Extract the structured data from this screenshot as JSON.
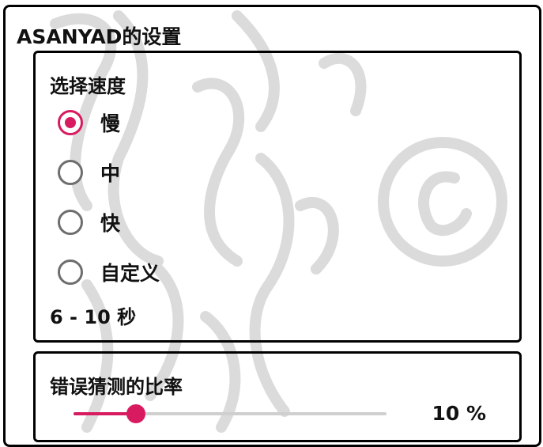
{
  "window": {
    "title": "ASANYAD的设置"
  },
  "speed": {
    "label": "选择速度",
    "options": [
      {
        "label": "慢",
        "selected": true
      },
      {
        "label": "中",
        "selected": false
      },
      {
        "label": "快",
        "selected": false
      },
      {
        "label": "自定义",
        "selected": false
      }
    ],
    "range_text": "6 - 10 秒"
  },
  "error_ratio": {
    "label": "错误猜测的比率",
    "value_text": "10 %",
    "value_fraction": 0.2
  },
  "colors": {
    "accent": "#d81b60",
    "border": "#000000",
    "radio_off": "#6e6e6e",
    "track": "#cfcfcf"
  }
}
